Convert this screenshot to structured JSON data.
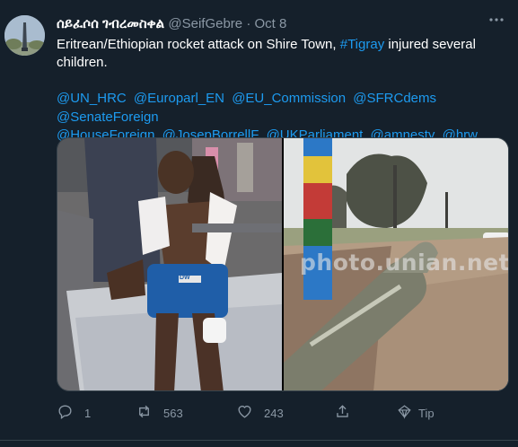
{
  "tweet": {
    "author_name": "ሰይፈሶሰ ገብረመስቀል",
    "author_handle": "@SeifGebre",
    "separator": "·",
    "date": "Oct 8",
    "text_before_link": "Eritrean/Ethiopian rocket attack on Shire Town, ",
    "hashtag": "#Tigray",
    "text_after_link": " injured several children.",
    "mentions": [
      "@UN_HRC",
      "@Europarl_EN",
      "@EU_Commission",
      "@SFRCdems",
      "@SenateForeign",
      "@HouseForeign",
      "@JosepBorrellF",
      "@UKParliament",
      "@amnesty",
      "@hrw"
    ],
    "media_watermark": "photo.unian.net",
    "shirt_logo": "DW"
  },
  "actions": {
    "reply_count": "1",
    "retweet_count": "563",
    "like_count": "243",
    "tip_label": "Tip"
  },
  "colors": {
    "background": "#15202b",
    "accent": "#1d9bf0",
    "muted": "#8b98a5"
  }
}
